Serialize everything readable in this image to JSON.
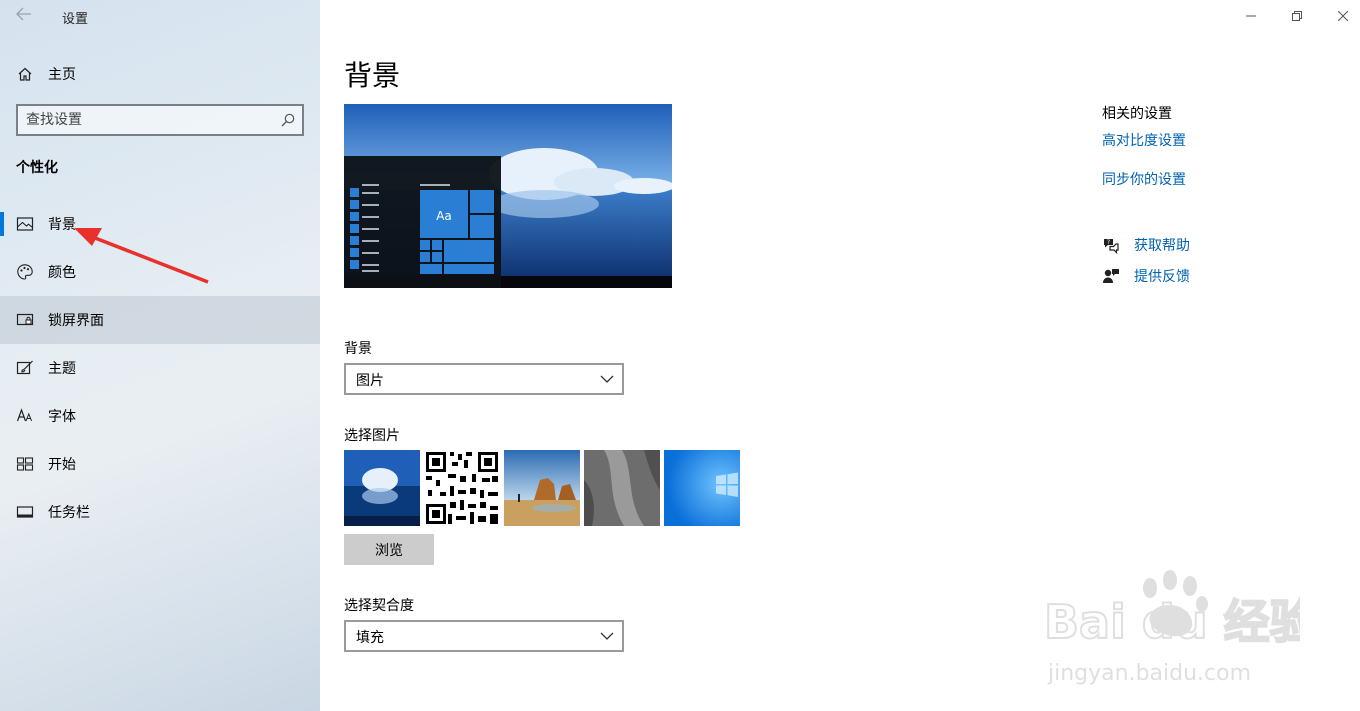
{
  "window": {
    "title": "设置"
  },
  "sidebar": {
    "home_label": "主页",
    "search_placeholder": "查找设置",
    "section_title": "个性化",
    "items": [
      {
        "label": "背景",
        "icon": "picture-icon"
      },
      {
        "label": "颜色",
        "icon": "palette-icon"
      },
      {
        "label": "锁屏界面",
        "icon": "lock-screen-icon"
      },
      {
        "label": "主题",
        "icon": "theme-brush-icon"
      },
      {
        "label": "字体",
        "icon": "font-icon"
      },
      {
        "label": "开始",
        "icon": "start-tiles-icon"
      },
      {
        "label": "任务栏",
        "icon": "taskbar-icon"
      }
    ]
  },
  "main": {
    "title": "背景",
    "preview_tile_text": "Aa",
    "background_label": "背景",
    "background_value": "图片",
    "choose_picture_label": "选择图片",
    "browse_label": "浏览",
    "fit_label": "选择契合度",
    "fit_value": "填充"
  },
  "related": {
    "title": "相关的设置",
    "links": [
      "高对比度设置",
      "同步你的设置"
    ],
    "help": [
      {
        "label": "获取帮助",
        "icon": "help-chat-icon"
      },
      {
        "label": "提供反馈",
        "icon": "feedback-icon"
      }
    ]
  },
  "watermark": {
    "brand": "Bai du 经验",
    "url": "jingyan.baidu.com"
  },
  "colors": {
    "accent": "#0078d7",
    "link": "#0063b1",
    "annotation_arrow": "#e8312a"
  }
}
